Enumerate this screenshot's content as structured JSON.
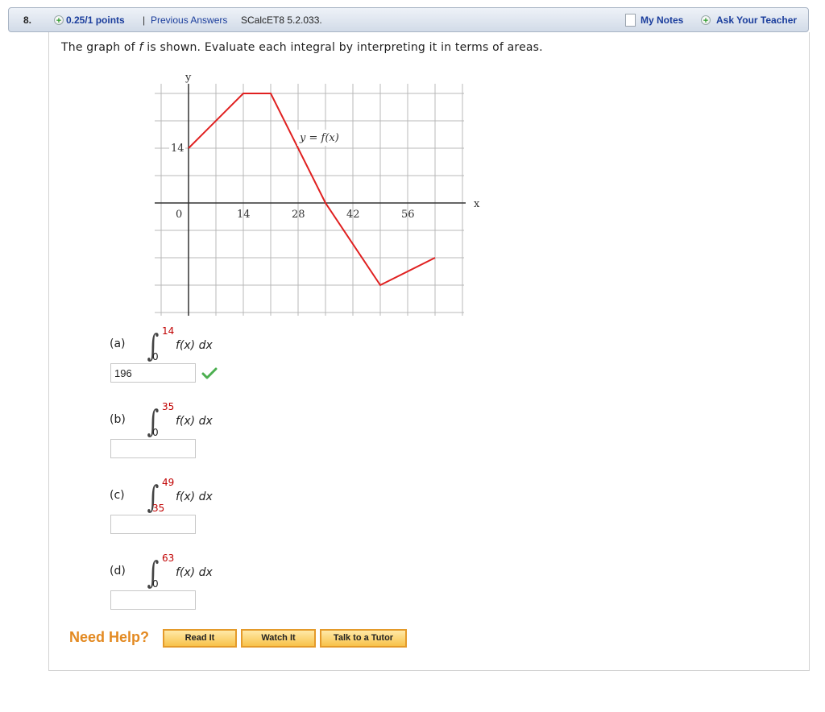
{
  "header": {
    "question_number": "8.",
    "points": "0.25/1 points",
    "separator": "|",
    "previous_answers": "Previous Answers",
    "problem_code": "SCalcET8 5.2.033.",
    "my_notes": "My Notes",
    "ask_teacher": "Ask Your Teacher"
  },
  "question": {
    "prompt_before": "The graph of ",
    "prompt_var": "f",
    "prompt_after": " is shown. Evaluate each integral by interpreting it in terms of areas."
  },
  "graph": {
    "y_axis_label": "y",
    "x_axis_label": "x",
    "curve_label": "y = f(x)",
    "x_ticks": [
      "0",
      "14",
      "28",
      "42",
      "56"
    ],
    "y_ticks": [
      "14"
    ],
    "line_color": "#e02020",
    "curve_points": [
      [
        0,
        14
      ],
      [
        14,
        28
      ],
      [
        21,
        28
      ],
      [
        35,
        0
      ],
      [
        49,
        -21
      ],
      [
        63,
        -14
      ]
    ]
  },
  "parts": [
    {
      "label": "(a)",
      "upper": "14",
      "lower": "0",
      "integrand": "f(x) dx",
      "answer": "196",
      "status": "correct"
    },
    {
      "label": "(b)",
      "upper": "35",
      "lower": "0",
      "integrand": "f(x) dx",
      "answer": ""
    },
    {
      "label": "(c)",
      "upper": "49",
      "lower": "35",
      "integrand": "f(x) dx",
      "answer": ""
    },
    {
      "label": "(d)",
      "upper": "63",
      "lower": "0",
      "integrand": "f(x) dx",
      "answer": ""
    }
  ],
  "help": {
    "label": "Need Help?",
    "read_it": "Read It",
    "watch_it": "Watch It",
    "talk_to_tutor": "Talk to a Tutor"
  },
  "colors": {
    "link": "#1a3d9c",
    "limit_red": "#c00000",
    "help_orange": "#e38a22",
    "check_green": "#4caf50"
  }
}
